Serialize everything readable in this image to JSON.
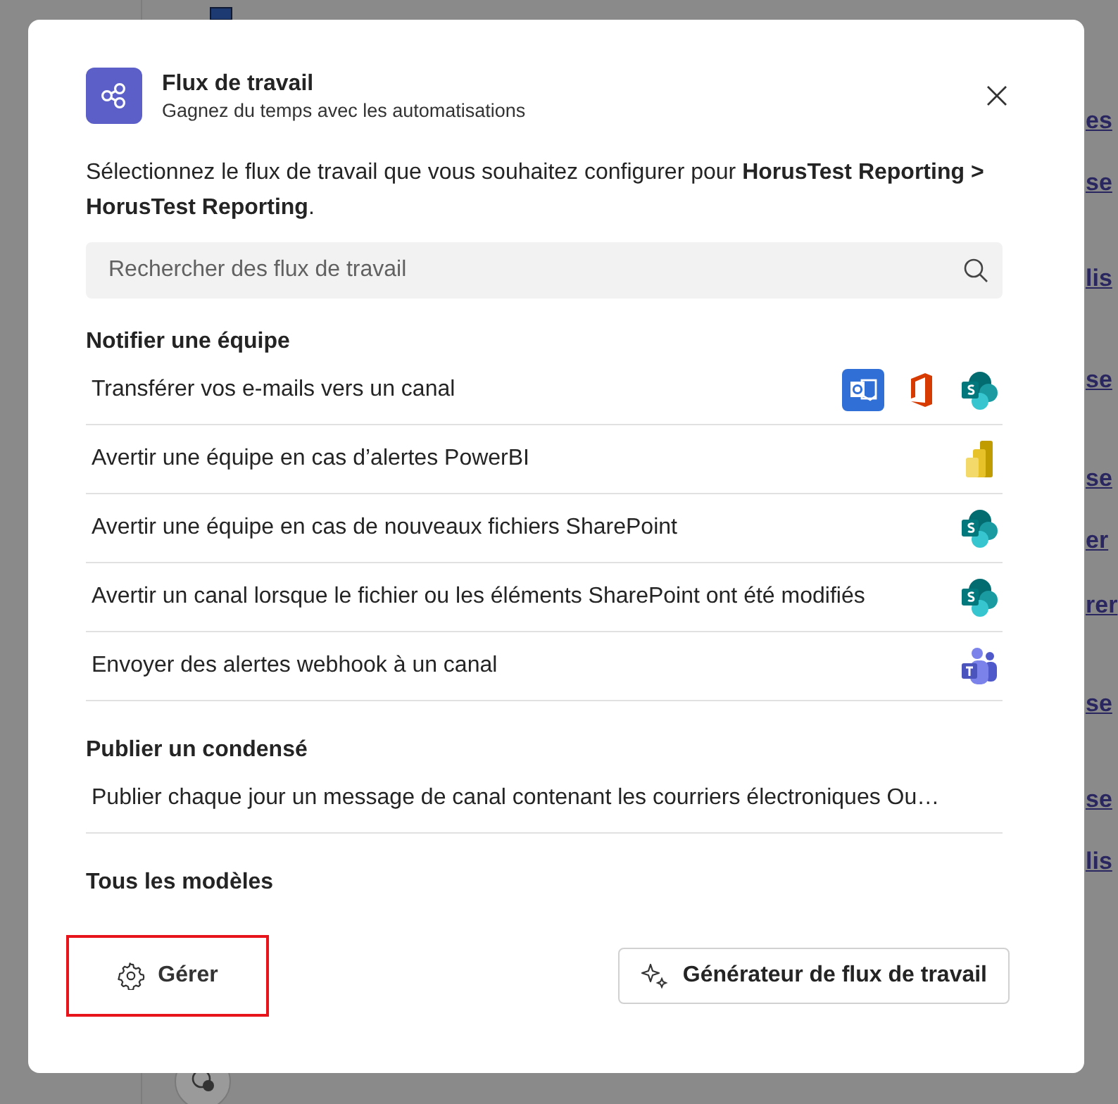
{
  "background": {
    "fragments": [
      "es",
      "se",
      "lis",
      "se",
      "se",
      "er",
      "rer",
      "se",
      "se",
      "lis"
    ]
  },
  "dialog": {
    "title": "Flux de travail",
    "subtitle": "Gagnez du temps avec les automatisations",
    "intro": "Sélectionnez le flux de travail que vous souhaitez configurer pour **HorusTest Reporting > HorusTest Reporting**.",
    "search": {
      "placeholder": "Rechercher des flux de travail"
    },
    "sections": [
      {
        "heading": "Notifier une équipe",
        "items": [
          {
            "label": "Transférer vos e-mails vers un canal",
            "apps": [
              {
                "kind": "outlook"
              },
              {
                "kind": "office"
              },
              {
                "kind": "sharepoint"
              }
            ]
          },
          {
            "label": "Avertir une équipe en cas d’alertes PowerBI",
            "apps": [
              {
                "kind": "powerbi"
              }
            ]
          },
          {
            "label": "Avertir une équipe en cas de nouveaux fichiers SharePoint",
            "apps": [
              {
                "kind": "sharepoint"
              }
            ]
          },
          {
            "label": "Avertir un canal lorsque le fichier ou les éléments SharePoint ont été modifiés",
            "apps": [
              {
                "kind": "sharepoint"
              }
            ]
          },
          {
            "label": "Envoyer des alertes webhook à un canal",
            "apps": [
              {
                "kind": "teams"
              }
            ]
          }
        ]
      },
      {
        "heading": "Publier un condensé",
        "items": [
          {
            "label": "Publier chaque jour un message de canal contenant les courriers électroniques Ou…"
          }
        ]
      },
      {
        "heading": "Tous les modèles"
      }
    ],
    "manage_button": {
      "label": "Gérer",
      "highlighted": true
    },
    "generator_button": {
      "label": "Générateur de flux de travail"
    }
  }
}
